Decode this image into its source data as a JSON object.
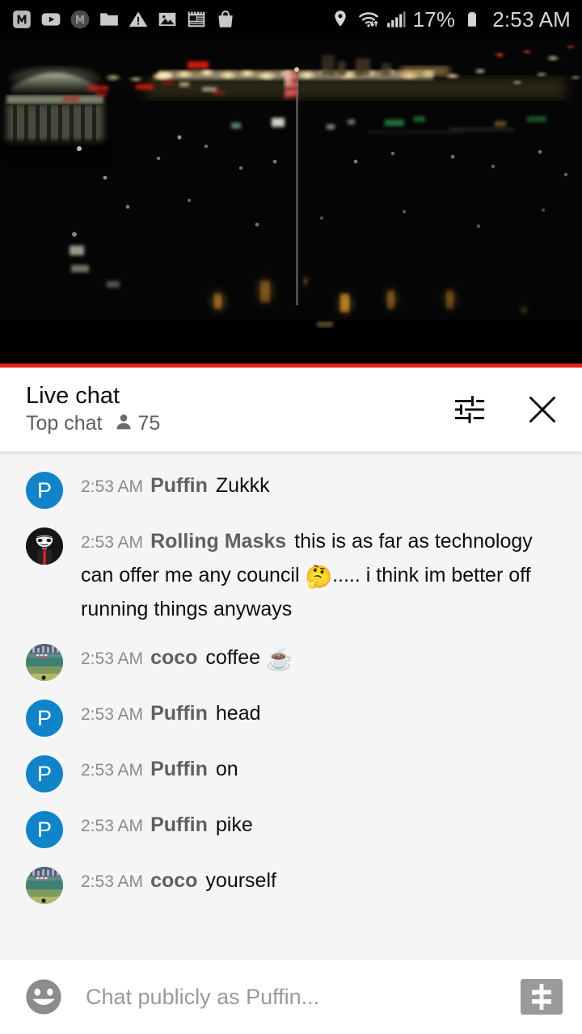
{
  "status_bar": {
    "icons": [
      "monzo-icon",
      "youtube-icon",
      "monzo-dark-icon",
      "folder-icon",
      "warning-icon",
      "photo-icon",
      "news-icon",
      "shopping-bag-icon"
    ],
    "location_icon": "location-pin-icon",
    "wifi_icon": "wifi-icon",
    "signal_icon": "cellular-signal-icon",
    "battery_percent": "17%",
    "battery_icon": "battery-icon",
    "time": "2:53 AM"
  },
  "video": {
    "description": "night cityscape live stream",
    "progress_color": "#e62117"
  },
  "chat_header": {
    "title": "Live chat",
    "mode_label": "Top chat",
    "viewer_icon": "person-icon",
    "viewer_count": "75",
    "settings_icon": "tune-icon",
    "close_icon": "close-icon"
  },
  "messages": [
    {
      "time": "2:53 AM",
      "author": "Puffin",
      "text": "Zukkk",
      "avatar_type": "letter",
      "avatar_letter": "P",
      "avatar_color": "#1184c9"
    },
    {
      "time": "2:53 AM",
      "author": "Rolling Masks",
      "text": "this is as far as technology can offer me any council ",
      "emoji": "🤔",
      "text_after": "..... i think im better off running things anyways",
      "avatar_type": "anon-mask",
      "avatar_color": "#151515"
    },
    {
      "time": "2:53 AM",
      "author": "coco",
      "text": "coffee ",
      "emoji": "☕",
      "text_after": "",
      "avatar_type": "ballpark",
      "avatar_color": "#6e8b6b"
    },
    {
      "time": "2:53 AM",
      "author": "Puffin",
      "text": "head",
      "avatar_type": "letter",
      "avatar_letter": "P",
      "avatar_color": "#1184c9"
    },
    {
      "time": "2:53 AM",
      "author": "Puffin",
      "text": "on",
      "avatar_type": "letter",
      "avatar_letter": "P",
      "avatar_color": "#1184c9"
    },
    {
      "time": "2:53 AM",
      "author": "Puffin",
      "text": "pike",
      "avatar_type": "letter",
      "avatar_letter": "P",
      "avatar_color": "#1184c9"
    },
    {
      "time": "2:53 AM",
      "author": "coco",
      "text": "yourself",
      "avatar_type": "ballpark",
      "avatar_color": "#6e8b6b"
    }
  ],
  "input_bar": {
    "emoji_icon": "emoji-smiley-icon",
    "placeholder": "Chat publicly as Puffin...",
    "value": "",
    "superchat_icon": "dollar-icon"
  }
}
